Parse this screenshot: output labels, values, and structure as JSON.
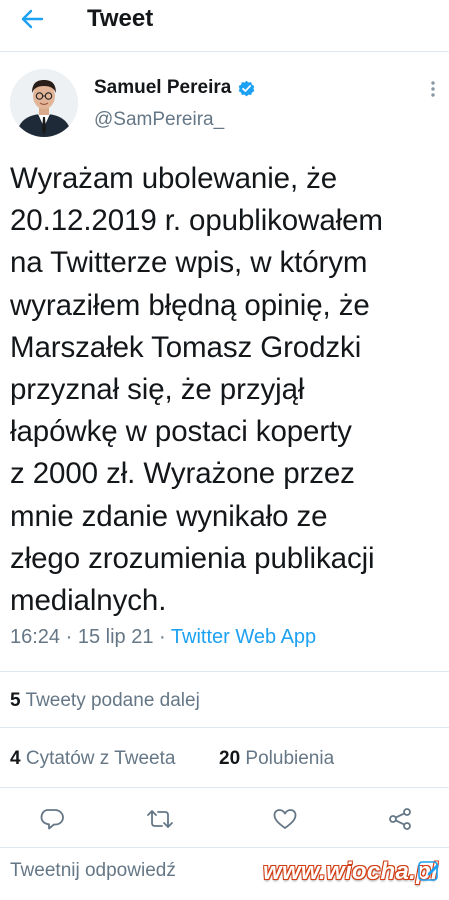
{
  "header": {
    "title": "Tweet",
    "back_icon": "arrow-left-icon"
  },
  "author": {
    "name": "Samuel Pereira",
    "handle": "@SamPereira_",
    "verified": true
  },
  "tweet": {
    "text": "Wyrażam ubolewanie, że\n20.12.2019 r. opublikowałem\nna Twitterze wpis, w którym\nwyraziłem błędną opinię, że\nMarszałek Tomasz Grodzki\nprzyznał się, że przyjął\nłapówkę w postaci koperty\nz 2000 zł. Wyrażone przez\nmnie zdanie wynikało ze\nzłego zrozumienia publikacji\nmedialnych.",
    "time": "16:24",
    "date": "15 lip 21",
    "separator": "·",
    "source_app": "Twitter Web App"
  },
  "stats": {
    "retweets_count": "5",
    "retweets_label": "Tweety podane dalej",
    "quotes_count": "4",
    "quotes_label": "Cytatów z Tweeta",
    "likes_count": "20",
    "likes_label": "Polubienia"
  },
  "actions": [
    "reply-icon",
    "retweet-icon",
    "like-icon",
    "share-icon"
  ],
  "reply_box": {
    "placeholder": "Tweetnij odpowiedź"
  },
  "watermark": {
    "text": "www.wiocha.pl"
  },
  "colors": {
    "accent": "#1da1f2",
    "secondary_text": "#657786",
    "primary_text": "#14171a",
    "watermark_outline": "#d23c12"
  }
}
